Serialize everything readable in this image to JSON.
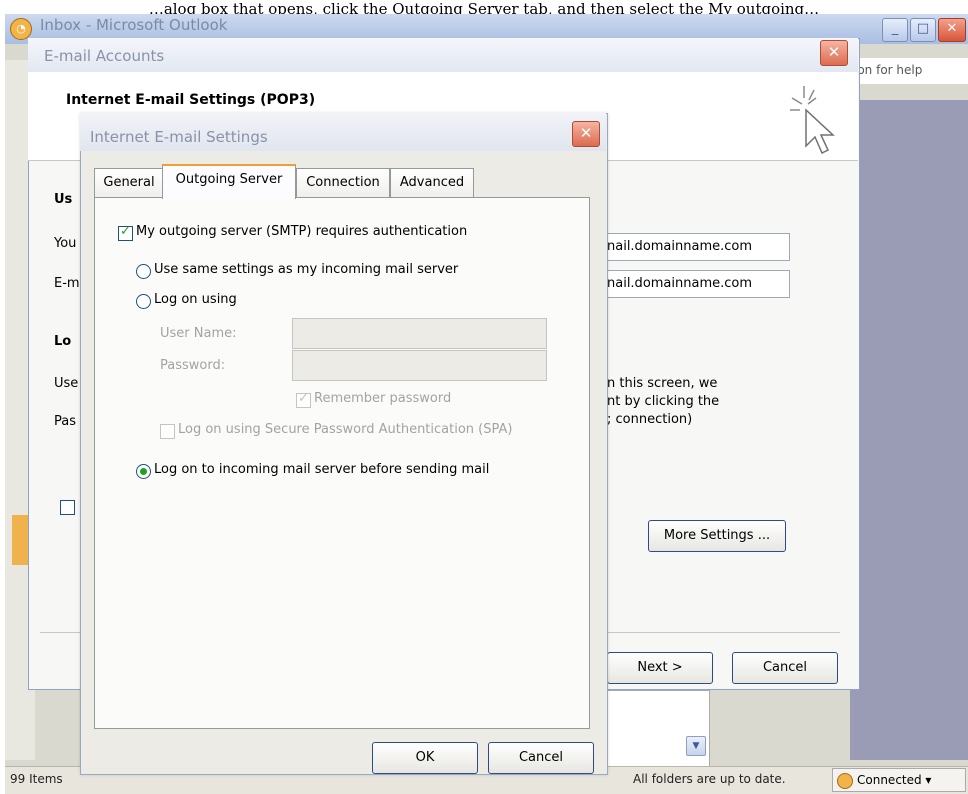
{
  "background_caption": "…alog box that opens, click the Outgoing Server tab, and then select the My outgoing…",
  "outlook": {
    "title": "Inbox - Microsoft Outlook",
    "help_placeholder": "ion for help",
    "status_items": "99 Items",
    "status_folders": "All folders are up to date.",
    "status_connection": "Connected ▾"
  },
  "email_accounts": {
    "title": "E-mail Accounts",
    "header": "Internet E-mail Settings (POP3)",
    "section_user": "Us",
    "label_your": "You",
    "label_email": "E-m",
    "section_logon": "Lo",
    "label_user": "Use",
    "label_pass": "Pas",
    "incoming_server": "nail.domainname.com",
    "outgoing_server": "nail.domainname.com",
    "info_line1": "n this screen, we",
    "info_line2": "nt by clicking the",
    "info_line3": "; connection)",
    "more_settings": "More Settings ...",
    "next": "Next >",
    "cancel": "Cancel"
  },
  "internet_settings": {
    "title": "Internet E-mail Settings",
    "tabs": [
      "General",
      "Outgoing Server",
      "Connection",
      "Advanced"
    ],
    "requires_auth": "My outgoing server (SMTP) requires authentication",
    "use_same": "Use same settings as my incoming mail server",
    "log_on_using": "Log on using",
    "user_name_label": "User Name:",
    "password_label": "Password:",
    "remember_password": "Remember password",
    "spa": "Log on using Secure Password Authentication (SPA)",
    "log_on_incoming": "Log on to incoming mail server before sending mail",
    "ok": "OK",
    "cancel": "Cancel"
  }
}
